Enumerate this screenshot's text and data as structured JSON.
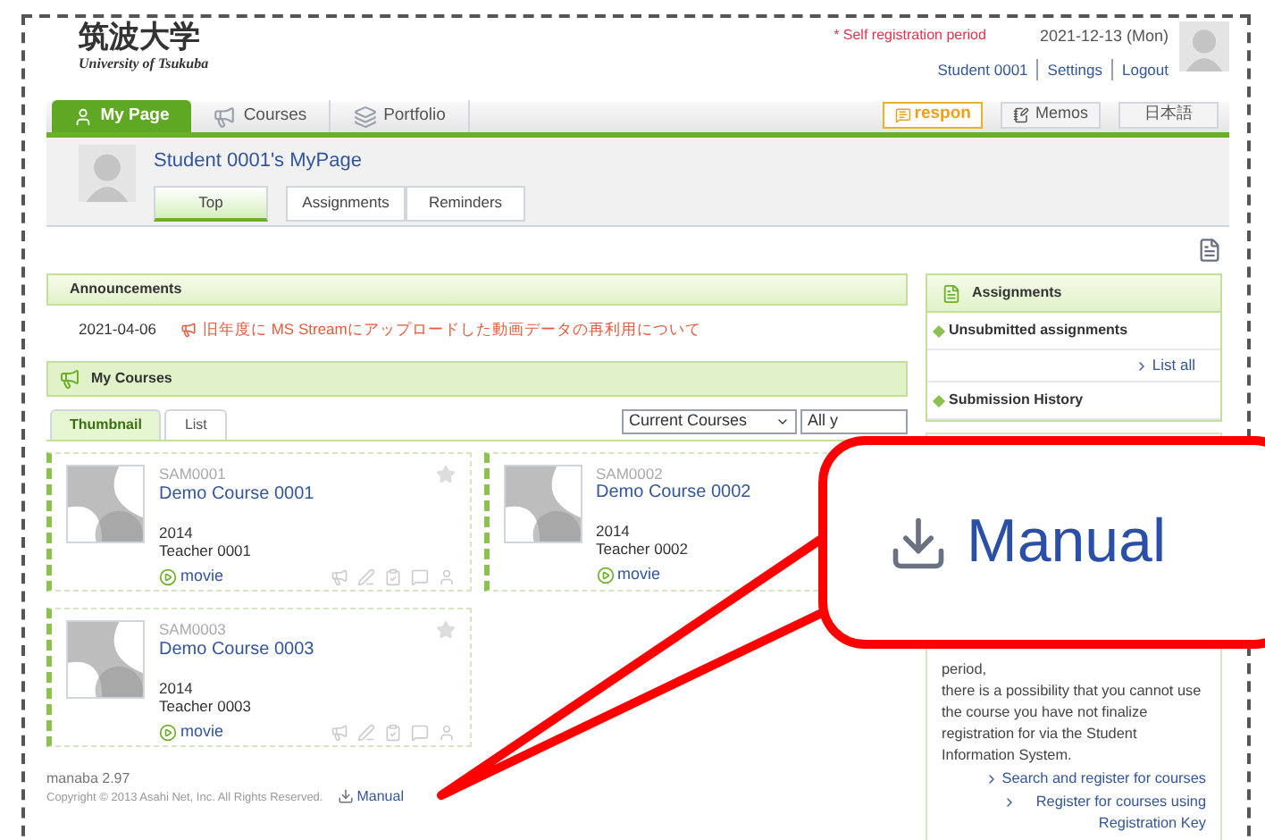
{
  "header": {
    "logo": "筑波大学",
    "logo_sub": "University of Tsukuba",
    "notice": "* Self registration period",
    "date": "2021-12-13 (Mon)",
    "links": [
      "Student 0001",
      "Settings",
      "Logout"
    ]
  },
  "nav": {
    "tabs": [
      {
        "label": "My Page",
        "kind": "user",
        "selected": true
      },
      {
        "label": "Courses",
        "kind": "courses",
        "selected": false
      },
      {
        "label": "Portfolio",
        "kind": "portfolio",
        "selected": false
      }
    ],
    "respon": "respon",
    "memos": "Memos",
    "language": "日本語"
  },
  "profile": {
    "title": "Student 0001's MyPage",
    "tabs": [
      {
        "label": "Top",
        "selected": true
      },
      {
        "label": "Assignments",
        "selected": false
      },
      {
        "label": "Reminders",
        "selected": false
      }
    ]
  },
  "announcements": {
    "title": "Announcements",
    "items": [
      {
        "date": "2021-04-06",
        "text": "旧年度に MS Streamにアップロードした動画データの再利用について"
      }
    ]
  },
  "courses": {
    "title": "My Courses",
    "view_tabs": [
      {
        "label": "Thumbnail",
        "selected": true
      },
      {
        "label": "List",
        "selected": false
      }
    ],
    "filter": "Current Courses",
    "year_filter": "All y",
    "cards": [
      {
        "code": "SAM0001",
        "title": "Demo Course 0001",
        "year": "2014",
        "teacher": "Teacher 0001",
        "link": "movie",
        "star": true,
        "icons": true
      },
      {
        "code": "SAM0002",
        "title": "Demo Course 0002",
        "year": "2014",
        "teacher": "Teacher 0002",
        "link": "movie",
        "star": false,
        "icons": false
      },
      {
        "code": "SAM0003",
        "title": "Demo Course 0003",
        "year": "2014",
        "teacher": "Teacher 0003",
        "link": "movie",
        "star": true,
        "icons": true
      }
    ]
  },
  "footer": {
    "version": "manaba 2.97",
    "copyright": "Copyright © 2013 Asahi Net, Inc. All Rights Reserved.",
    "manual": "Manual"
  },
  "assignments": {
    "title": "Assignments",
    "sections": [
      {
        "label": "Unsubmitted assignments",
        "link": "List all"
      },
      {
        "label": "Submission History"
      }
    ]
  },
  "registration": {
    "lines": [
      "period,",
      "there is a possibility that you cannot use the course you have not finalize registration for via the Student Information System."
    ],
    "links": [
      "Search and register for courses",
      "Register for courses using Registration Key"
    ]
  },
  "callout": {
    "label": "Manual"
  }
}
